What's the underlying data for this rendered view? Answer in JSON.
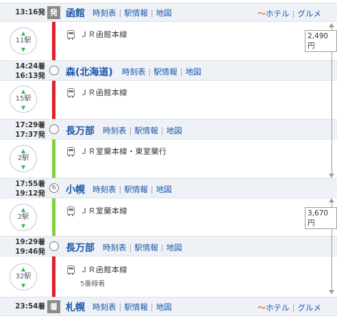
{
  "colors": {
    "red_line": "#e0202a",
    "green_line": "#7fd03a",
    "link": "#1a56a8",
    "badge_gray": "#8a8a8a"
  },
  "links": {
    "timetable": "時刻表",
    "station_info": "駅情報",
    "map": "地図"
  },
  "extras": {
    "hotel": "ホテル",
    "gourmet": "グルメ"
  },
  "stations": [
    {
      "times": [
        "13:16発"
      ],
      "badge": "発",
      "name": "函館"
    },
    {
      "times": [
        "14:24着",
        "16:13発"
      ],
      "name": "森(北海道)"
    },
    {
      "times": [
        "17:29着",
        "17:37発"
      ],
      "name": "長万部"
    },
    {
      "times": [
        "17:55着",
        "19:12発"
      ],
      "name": "小幌"
    },
    {
      "times": [
        "19:29着",
        "19:46発"
      ],
      "name": "長万部"
    },
    {
      "times": [
        "23:54着"
      ],
      "badge": "着",
      "name": "札幌"
    }
  ],
  "segments": [
    {
      "stops": "11駅",
      "line": "ＪＲ函館本線"
    },
    {
      "stops": "15駅",
      "line": "ＪＲ函館本線"
    },
    {
      "stops": "2駅",
      "line": "ＪＲ室蘭本線・東室蘭行"
    },
    {
      "stops": "2駅",
      "line": "ＪＲ室蘭本線"
    },
    {
      "stops": "32駅",
      "line": "ＪＲ函館本線",
      "platform": "5番線着"
    }
  ],
  "fares": [
    "2,490円",
    "3,670円"
  ]
}
